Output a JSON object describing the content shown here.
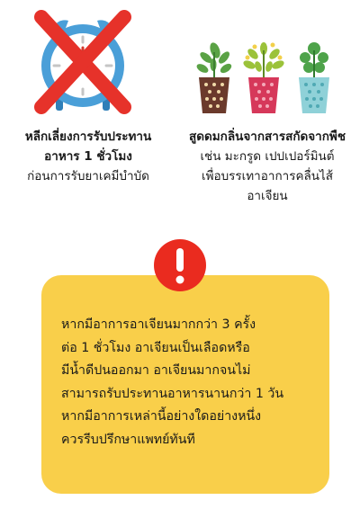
{
  "left_tip": {
    "title_line1": "หลีกเลี่ยงการรับประทาน",
    "title_line2": "อาหาร 1 ชั่วโมง",
    "subtitle": "ก่อนการรับยาเคมีบำบัด",
    "illustration_icon": "alarm-clock-crossed-icon"
  },
  "right_tip": {
    "title": "สูดดมกลิ่นจากสารสกัดจากพืช",
    "line2": "เช่น มะกรูด เปปเปอร์มินต์",
    "line3": "เพื่อบรรเทาอาการคลื่นไส้",
    "line4": "อาเจียน",
    "illustration_icon": "potted-herbs-icon"
  },
  "warning": {
    "icon": "exclamation-icon",
    "lines": [
      "หากมีอาการอาเจียนมากกว่า 3 ครั้ง",
      "ต่อ 1 ชั่วโมง อาเจียนเป็นเลือดหรือ",
      "มีน้ำดีปนออกมา อาเจียนมากจนไม่",
      "สามารถรับประทานอาหารนานกว่า 1 วัน",
      "หากมีอาการเหล่านี้อย่างใดอย่างหนึ่ง",
      "ควรรีบปรึกษาแพทย์ทันที"
    ]
  },
  "colors": {
    "alert_bg": "#f9cf4a",
    "warning_red": "#ea2b1f",
    "cross_red": "#e6322a",
    "clock_blue": "#4a9fd8",
    "clock_face": "#ffffff"
  }
}
